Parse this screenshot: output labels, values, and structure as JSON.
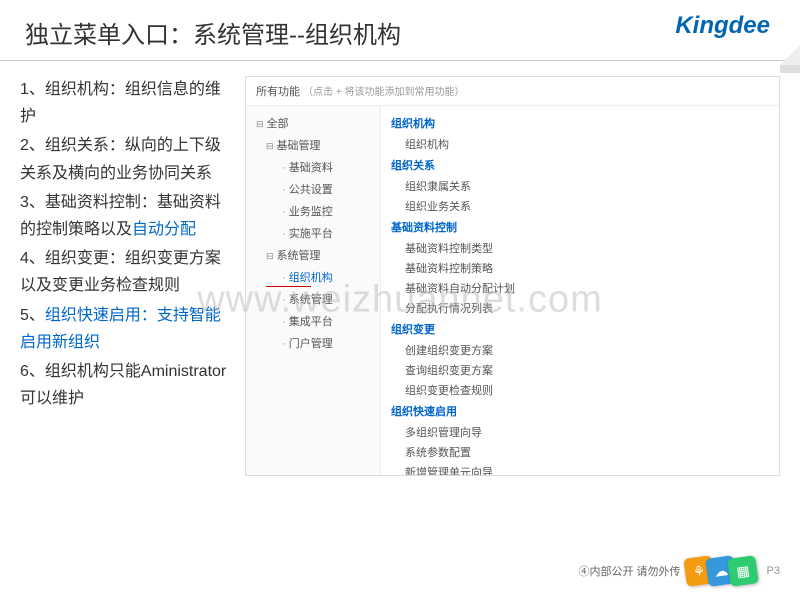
{
  "header": {
    "title": "独立菜单入口：系统管理--组织机构",
    "logo": "Kingdee"
  },
  "notes": {
    "n1a": "1、组织机构：组织信息的维护",
    "n2a": "2、组织关系：纵向的上下级关系及横向的业务协同关系",
    "n3a": "3、基础资料控制：基础资料的控制策略以及",
    "n3b": "自动分配",
    "n4a": "4、组织变更：组织变更方案以及变更业务检查规则",
    "n5a": "5、",
    "n5b": "组织快速启用：支持智能启用新组织",
    "n6a": "6、组织机构只能Aministrator可以维护"
  },
  "func": {
    "allLabel": "所有功能",
    "hint": "（点击 + 将该功能添加到常用功能）",
    "rootAll": "全部",
    "basicMgmt": "基础管理",
    "basicItems": [
      "基础资料",
      "公共设置",
      "业务监控",
      "实施平台"
    ],
    "sysMgmt": "系统管理",
    "sysItems": [
      "组织机构",
      "系统管理",
      "集成平台",
      "门户管理"
    ],
    "cats": [
      {
        "title": "组织机构",
        "items": [
          "组织机构"
        ]
      },
      {
        "title": "组织关系",
        "items": [
          "组织隶属关系",
          "组织业务关系"
        ]
      },
      {
        "title": "基础资料控制",
        "items": [
          "基础资料控制类型",
          "基础资料控制策略",
          "基础资料自动分配计划",
          "分配执行情况列表"
        ]
      },
      {
        "title": "组织变更",
        "items": [
          "创建组织变更方案",
          "查询组织变更方案",
          "组织变更检查规则"
        ]
      },
      {
        "title": "组织快速启用",
        "items": [
          "多组织管理向导",
          "系统参数配置",
          "新增管理单元向导"
        ]
      }
    ]
  },
  "footer": {
    "text": "④内部公开 请勿外传",
    "page": "P3"
  },
  "watermark": "www.weizhuannet.com"
}
